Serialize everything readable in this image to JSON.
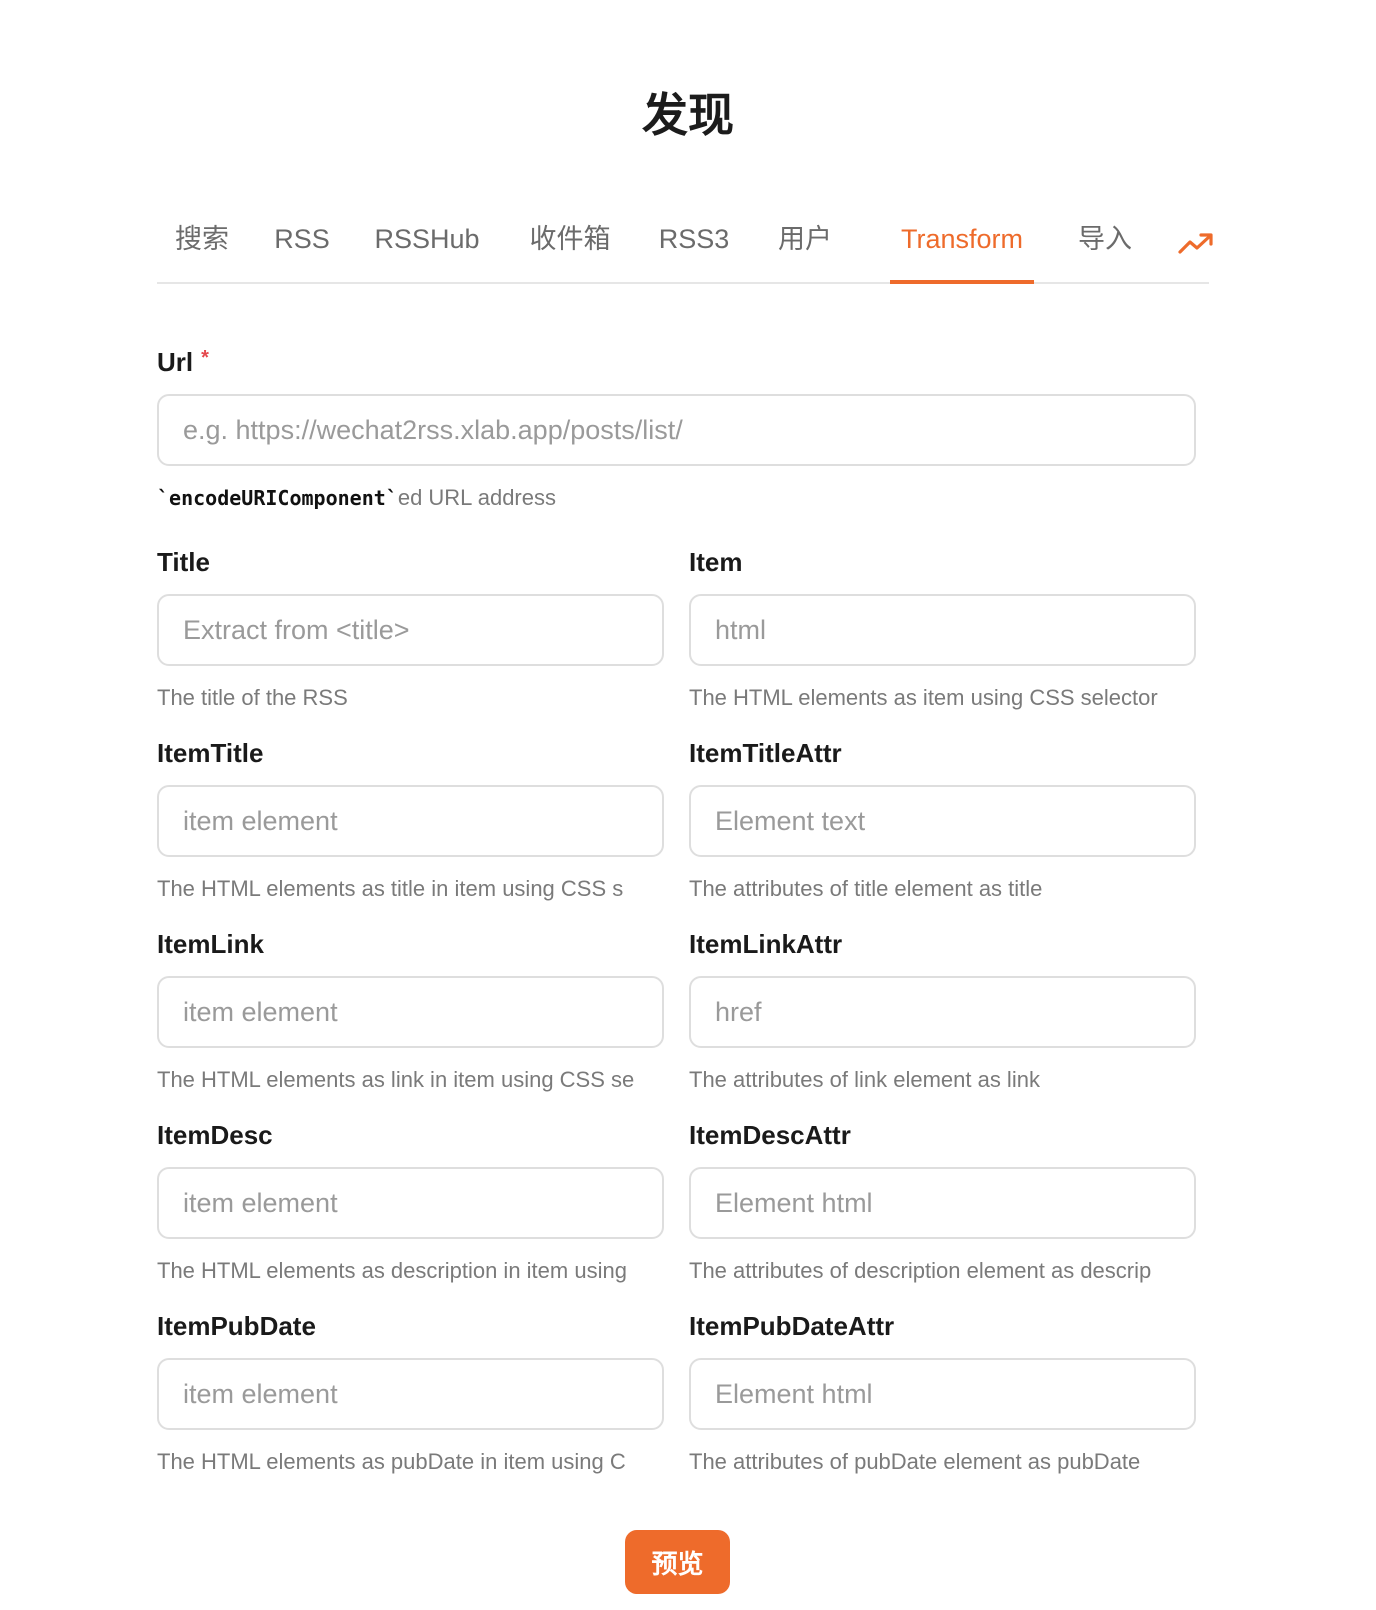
{
  "page": {
    "title": "发现"
  },
  "tabs": [
    {
      "label": "搜索"
    },
    {
      "label": "RSS"
    },
    {
      "label": "RSSHub"
    },
    {
      "label": "收件箱"
    },
    {
      "label": "RSS3"
    },
    {
      "label": "用户"
    },
    {
      "label": "Transform",
      "active": true
    },
    {
      "label": "导入"
    }
  ],
  "trend_icon": "trending-up-icon",
  "accent_color": "#ee6b2b",
  "form": {
    "url": {
      "label": "Url",
      "required_mark": "*",
      "value": "",
      "placeholder": "e.g. https://wechat2rss.xlab.app/posts/list/",
      "help_code": "`encodeURIComponent`",
      "help_text": "ed URL address"
    },
    "title": {
      "label": "Title",
      "value": "",
      "placeholder": "Extract from <title>",
      "help": "The title of the RSS"
    },
    "item": {
      "label": "Item",
      "value": "",
      "placeholder": "html",
      "help": "The HTML elements as item using CSS selector"
    },
    "item_title": {
      "label": "ItemTitle",
      "value": "",
      "placeholder": "item element",
      "help": "The HTML elements as title in item using CSS s"
    },
    "item_title_attr": {
      "label": "ItemTitleAttr",
      "value": "",
      "placeholder": "Element text",
      "help": "The attributes of title element as title"
    },
    "item_link": {
      "label": "ItemLink",
      "value": "",
      "placeholder": "item element",
      "help": "The HTML elements as link in item using CSS se"
    },
    "item_link_attr": {
      "label": "ItemLinkAttr",
      "value": "",
      "placeholder": "href",
      "help": "The attributes of link element as link"
    },
    "item_desc": {
      "label": "ItemDesc",
      "value": "",
      "placeholder": "item element",
      "help": "The HTML elements as description in item using"
    },
    "item_desc_attr": {
      "label": "ItemDescAttr",
      "value": "",
      "placeholder": "Element html",
      "help": "The attributes of description element as descrip"
    },
    "item_pub_date": {
      "label": "ItemPubDate",
      "value": "",
      "placeholder": "item element",
      "help": "The HTML elements as pubDate in item using C"
    },
    "item_pub_date_attr": {
      "label": "ItemPubDateAttr",
      "value": "",
      "placeholder": "Element html",
      "help": "The attributes of pubDate element as pubDate"
    }
  },
  "preview_button": {
    "label": "预览"
  }
}
